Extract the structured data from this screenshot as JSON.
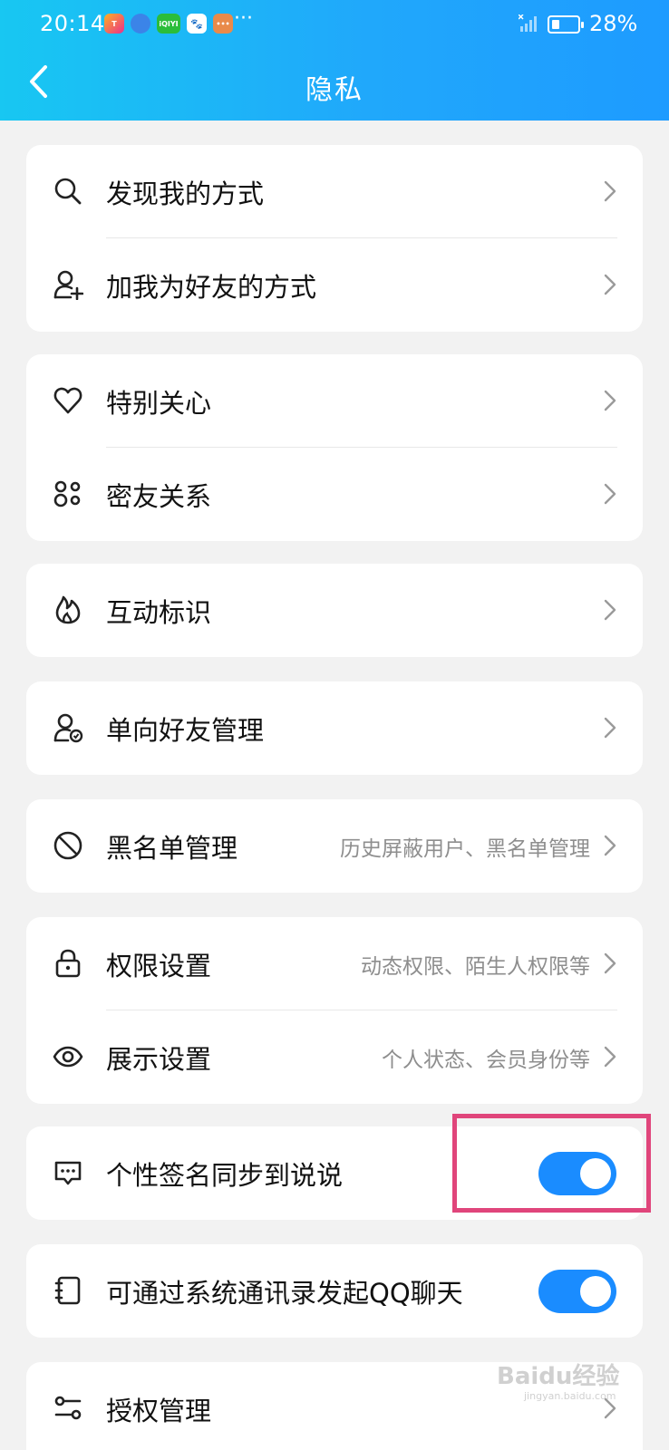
{
  "status_bar": {
    "time": "20:14",
    "app_icons": [
      "T",
      "",
      "iQIYI",
      "",
      ""
    ],
    "more": "···",
    "battery_percent": "28%"
  },
  "header": {
    "title": "隐私"
  },
  "accent_color": "#1a8cff",
  "highlight_color": "#e0457b",
  "sections": [
    {
      "items": [
        {
          "icon": "search-icon",
          "label": "发现我的方式",
          "sub": ""
        },
        {
          "icon": "add-friend-icon",
          "label": "加我为好友的方式",
          "sub": ""
        }
      ]
    },
    {
      "items": [
        {
          "icon": "heart-icon",
          "label": "特别关心",
          "sub": ""
        },
        {
          "icon": "close-friends-icon",
          "label": "密友关系",
          "sub": ""
        }
      ]
    },
    {
      "items": [
        {
          "icon": "flame-icon",
          "label": "互动标识",
          "sub": ""
        }
      ]
    },
    {
      "items": [
        {
          "icon": "one-way-friend-icon",
          "label": "单向好友管理",
          "sub": ""
        }
      ]
    },
    {
      "items": [
        {
          "icon": "block-icon",
          "label": "黑名单管理",
          "sub": "历史屏蔽用户、黑名单管理"
        }
      ]
    },
    {
      "items": [
        {
          "icon": "lock-icon",
          "label": "权限设置",
          "sub": "动态权限、陌生人权限等"
        },
        {
          "icon": "eye-icon",
          "label": "展示设置",
          "sub": "个人状态、会员身份等"
        }
      ]
    },
    {
      "items": [
        {
          "icon": "signature-icon",
          "label": "个性签名同步到说说",
          "toggle_on": true
        }
      ]
    },
    {
      "items": [
        {
          "icon": "contacts-icon",
          "label": "可通过系统通讯录发起QQ聊天",
          "toggle_on": true
        }
      ]
    },
    {
      "items": [
        {
          "icon": "authorization-icon",
          "label": "授权管理",
          "sub": ""
        }
      ]
    }
  ],
  "watermark": {
    "text": "Baidu经验",
    "url": "jingyan.baidu.com"
  }
}
